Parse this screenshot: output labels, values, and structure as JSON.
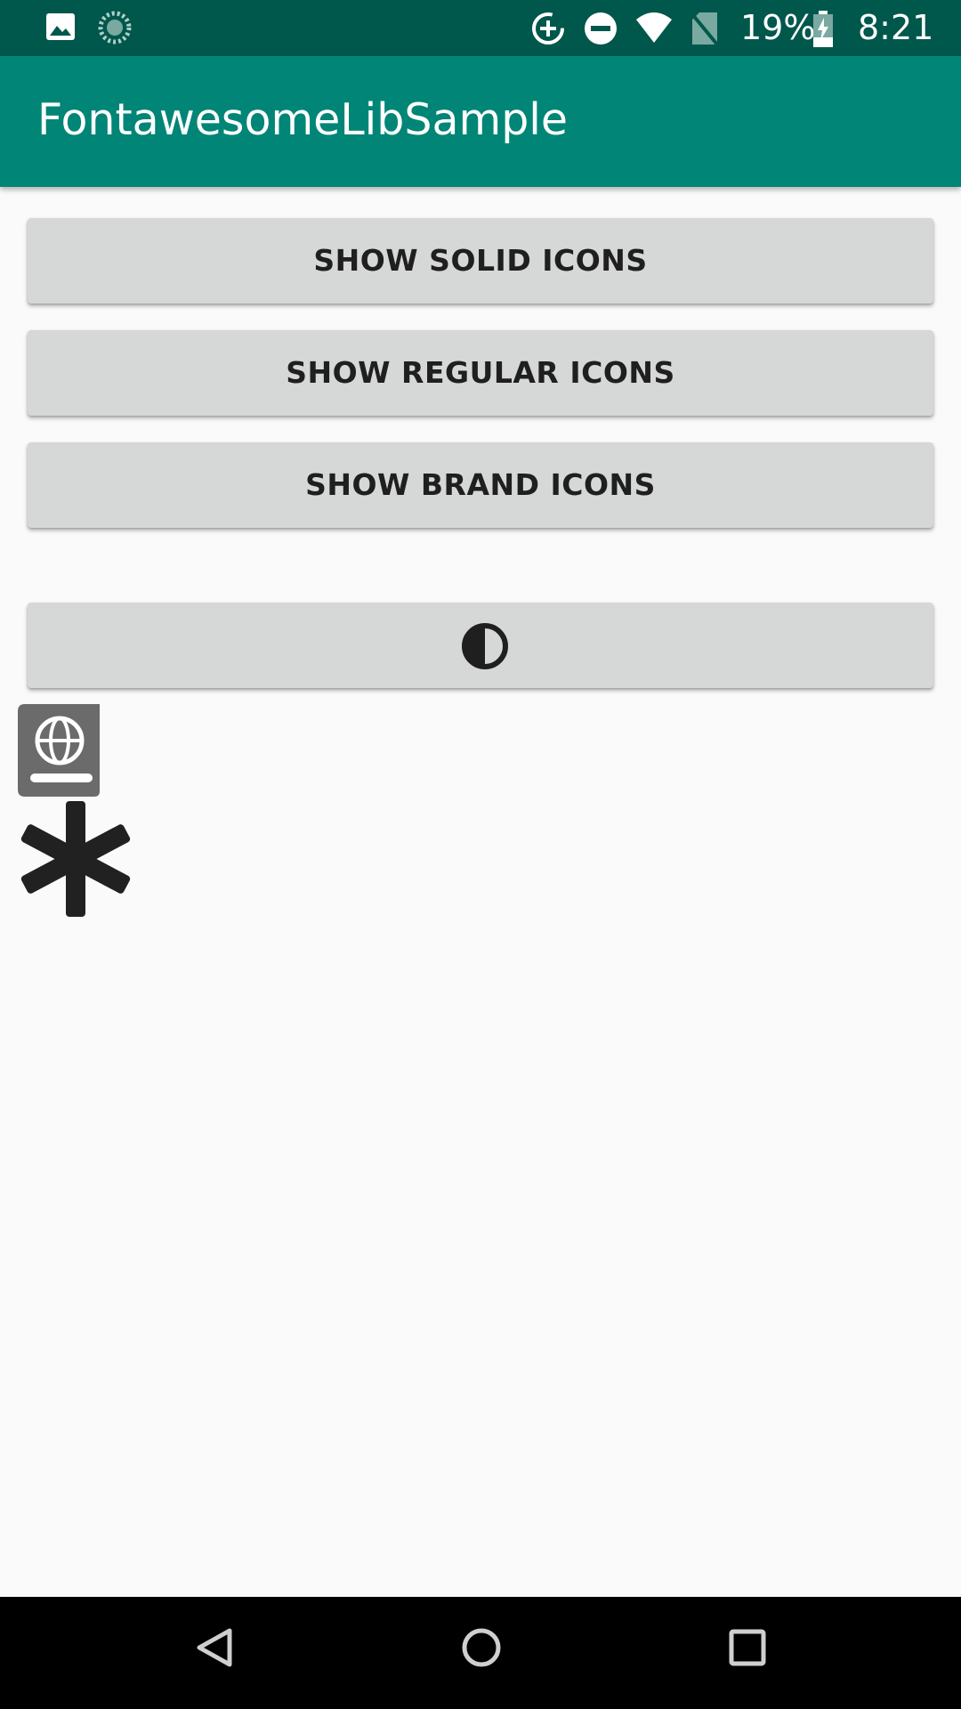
{
  "status_bar": {
    "battery_percent": "19%",
    "time": "8:21",
    "icons": [
      "image-icon",
      "loading-spinner-icon",
      "data-saver-icon",
      "do-not-disturb-icon",
      "wifi-icon",
      "no-sim-icon",
      "battery-charging-icon"
    ]
  },
  "app_bar": {
    "title": "FontawesomeLibSample",
    "color": "#008577"
  },
  "buttons": {
    "solid": "SHOW SOLID ICONS",
    "regular": "SHOW REGULAR ICONS",
    "brand": "SHOW BRAND ICONS",
    "adjust_icon": "adjust-icon"
  },
  "icons_shown": [
    "atlas-book-icon",
    "asterisk-icon"
  ],
  "nav_bar": {
    "buttons": [
      "back-icon",
      "home-icon",
      "recents-icon"
    ]
  },
  "colors": {
    "status_bar": "#00574b",
    "app_bar": "#008577",
    "background": "#fafafa",
    "button": "#d6d7d7"
  }
}
